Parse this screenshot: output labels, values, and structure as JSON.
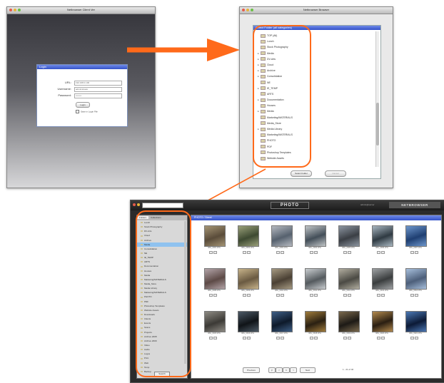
{
  "colors": {
    "arrow": "#ff6a1a",
    "header_blue": "#3f5cd8",
    "selection": "#8fc2ef"
  },
  "window1": {
    "title": "Netbrowser Client Ver",
    "login": {
      "header": "Login",
      "fields": [
        {
          "label": "URL:",
          "value": "192.168.0.100"
        },
        {
          "label": "Username:",
          "value": "administrator"
        },
        {
          "label": "Password:",
          "value": "••••••••"
        }
      ],
      "button": "Login",
      "remember": "Save in Login File"
    }
  },
  "window2": {
    "title": "Netbrowser Browser",
    "panel_header": "Select Folder (all categories)",
    "categories": [
      {
        "label": "TOP (All)",
        "expandable": false
      },
      {
        "label": "Lunch",
        "expandable": false
      },
      {
        "label": "Stock Photography",
        "expandable": false
      },
      {
        "label": "Media",
        "expandable": true
      },
      {
        "label": "DV-Arts",
        "expandable": true
      },
      {
        "label": "Cloud",
        "expandable": true
      },
      {
        "label": "Archive",
        "expandable": true
      },
      {
        "label": "Consolidation",
        "expandable": true
      },
      {
        "label": "NE",
        "expandable": false
      },
      {
        "label": "IE_TEMP",
        "expandable": true
      },
      {
        "label": "ARTS",
        "expandable": false
      },
      {
        "label": "Documentation",
        "expandable": true
      },
      {
        "label": "Houses",
        "expandable": false
      },
      {
        "label": "Media",
        "expandable": true
      },
      {
        "label": "Marketing/MATERIALS",
        "expandable": false
      },
      {
        "label": "Media_Store",
        "expandable": false
      },
      {
        "label": "Media Library",
        "expandable": true
      },
      {
        "label": "Marketing/MATERIALS",
        "expandable": false
      },
      {
        "label": "PHOTO",
        "expandable": false
      },
      {
        "label": "PDF",
        "expandable": false
      },
      {
        "label": "Photoshop Templates",
        "expandable": false
      },
      {
        "label": "Website Assets",
        "expandable": false
      }
    ],
    "buttons": {
      "primary": "Select Folder",
      "secondary": "Cancel"
    }
  },
  "window3": {
    "app_title": "PHOTO",
    "user": "admin@server",
    "brand": "NETBROWSER",
    "sidebar_tabs": [
      "Folders",
      "Collections"
    ],
    "sidebar_items": [
      "Lunch",
      "Stock Photography",
      "DV-Arts",
      "Cloud",
      "Archive",
      "Media",
      "Consolidation",
      "NE",
      "IE_TEMP",
      "ARTS",
      "Documentation",
      "Houses",
      "Media",
      "Marketing/MATERIALS",
      "Media_Store",
      "Media Library",
      "Marketing/MATERIALS",
      "PHOTO",
      "PDF",
      "Photoshop Templates",
      "Website Assets",
      "Downloads",
      "Clients",
      "Events",
      "Scans",
      "Projects",
      "Archive 2008",
      "Archive 2009",
      "Video",
      "Audio",
      "Logos",
      "Print",
      "Web",
      "Temp",
      "Backup"
    ],
    "selected_index": 5,
    "sidebar_footer": "Search",
    "main_header": "PHOTO / Street",
    "photos": [
      {
        "caption": "IMG_0001.JPG",
        "c1": "#5a4c3a",
        "c2": "#a59575"
      },
      {
        "caption": "IMG_0002.JPG",
        "c1": "#3e4a32",
        "c2": "#9aa07a"
      },
      {
        "caption": "IMG_0003.JPG",
        "c1": "#56616e",
        "c2": "#b5b9c0"
      },
      {
        "caption": "IMG_0004.JPG",
        "c1": "#434e58",
        "c2": "#c1c5c7"
      },
      {
        "caption": "IMG_0005.JPG",
        "c1": "#3b3f45",
        "c2": "#8c95a0"
      },
      {
        "caption": "IMG_0006.JPG",
        "c1": "#2f3a42",
        "c2": "#a8b6c0"
      },
      {
        "caption": "IMG_0007.JPG",
        "c1": "#1f3f72",
        "c2": "#6e97cc"
      },
      {
        "caption": "IMG_0008.JPG",
        "c1": "#5d4a46",
        "c2": "#b3a4a8"
      },
      {
        "caption": "IMG_0009.JPG",
        "c1": "#6a5a42",
        "c2": "#c7b38a"
      },
      {
        "caption": "IMG_0010.JPG",
        "c1": "#4a4034",
        "c2": "#a69a82"
      },
      {
        "caption": "IMG_0011.JPG",
        "c1": "#545a5e",
        "c2": "#c9cdd0"
      },
      {
        "caption": "IMG_0012.JPG",
        "c1": "#4b4a44",
        "c2": "#b1ad9f"
      },
      {
        "caption": "IMG_0013.JPG",
        "c1": "#3a3d3e",
        "c2": "#9ea1a3"
      },
      {
        "caption": "IMG_0014.JPG",
        "c1": "#4d5f7a",
        "c2": "#a7bfdc"
      },
      {
        "caption": "IMG_0015.JPG",
        "c1": "#3c3a36",
        "c2": "#8d8a83"
      },
      {
        "caption": "IMG_0016.JPG",
        "c1": "#101418",
        "c2": "#4d5a66"
      },
      {
        "caption": "IMG_0017.JPG",
        "c1": "#0e1a2a",
        "c2": "#3f5f86"
      },
      {
        "caption": "IMG_0018.JPG",
        "c1": "#2a2012",
        "c2": "#a07c3c"
      },
      {
        "caption": "IMG_0019.JPG",
        "c1": "#1d1a16",
        "c2": "#7b6a4e"
      },
      {
        "caption": "IMG_0020.JPG",
        "c1": "#2a1e12",
        "c2": "#b38a4e"
      },
      {
        "caption": "IMG_0021.JPG",
        "c1": "#0c1a36",
        "c2": "#4c78b4"
      }
    ],
    "pager": {
      "prev": "Previous",
      "first": "|<",
      "back": "<",
      "page": "1",
      "fwd": ">",
      "next": "Next",
      "per_page_label": "1 - 21 of 40"
    }
  }
}
